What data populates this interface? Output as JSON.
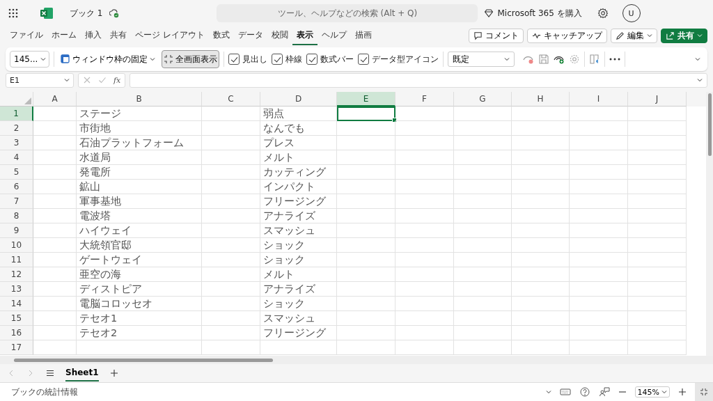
{
  "header": {
    "title": "ブック 1",
    "search": {
      "placeholder": "ツール、ヘルプなどの検索 (Alt + Q)"
    },
    "buy": "Microsoft 365 を購入",
    "avatar": "U"
  },
  "tabs": [
    {
      "label": "ファイル",
      "selected": false
    },
    {
      "label": "ホーム",
      "selected": false
    },
    {
      "label": "挿入",
      "selected": false
    },
    {
      "label": "共有",
      "selected": false
    },
    {
      "label": "ページ レイアウト",
      "selected": false
    },
    {
      "label": "数式",
      "selected": false
    },
    {
      "label": "データ",
      "selected": false
    },
    {
      "label": "校閲",
      "selected": false
    },
    {
      "label": "表示",
      "selected": true
    },
    {
      "label": "ヘルプ",
      "selected": false
    },
    {
      "label": "描画",
      "selected": false
    }
  ],
  "actions": {
    "comment": "コメント",
    "catchup": "キャッチアップ",
    "edit": "編集",
    "share": "共有"
  },
  "toolbar": {
    "zoom": "145...",
    "freeze": "ウィンドウ枠の固定",
    "fullscreen": {
      "label": "全画面表示",
      "selected": true
    },
    "checkboxes": [
      {
        "label": "見出し",
        "checked": true
      },
      {
        "label": "枠線",
        "checked": true
      },
      {
        "label": "数式バー",
        "checked": true
      },
      {
        "label": "データ型アイコン",
        "checked": true
      }
    ],
    "style": "既定"
  },
  "formula_bar": {
    "name_box": "E1",
    "function_label": "fx"
  },
  "columns": [
    {
      "label": "A",
      "selected": false
    },
    {
      "label": "B",
      "selected": false
    },
    {
      "label": "C",
      "selected": false
    },
    {
      "label": "D",
      "selected": false
    },
    {
      "label": "E",
      "selected": true
    },
    {
      "label": "F",
      "selected": false
    },
    {
      "label": "G",
      "selected": false
    },
    {
      "label": "H",
      "selected": false
    },
    {
      "label": "I",
      "selected": false
    },
    {
      "label": "J",
      "selected": false
    }
  ],
  "rows": [
    {
      "label": "1",
      "selected": true,
      "cells": [
        null,
        "ステージ",
        null,
        "弱点"
      ]
    },
    {
      "label": "2",
      "selected": false,
      "cells": [
        null,
        "市街地",
        null,
        "なんでも"
      ]
    },
    {
      "label": "3",
      "selected": false,
      "cells": [
        null,
        "石油プラットフォーム",
        null,
        "プレス"
      ]
    },
    {
      "label": "4",
      "selected": false,
      "cells": [
        null,
        "水道局",
        null,
        "メルト"
      ]
    },
    {
      "label": "5",
      "selected": false,
      "cells": [
        null,
        "発電所",
        null,
        "カッティング"
      ]
    },
    {
      "label": "6",
      "selected": false,
      "cells": [
        null,
        "鉱山",
        null,
        "インパクト"
      ]
    },
    {
      "label": "7",
      "selected": false,
      "cells": [
        null,
        "軍事基地",
        null,
        "フリージング"
      ]
    },
    {
      "label": "8",
      "selected": false,
      "cells": [
        null,
        "電波塔",
        null,
        "アナライズ"
      ]
    },
    {
      "label": "9",
      "selected": false,
      "cells": [
        null,
        "ハイウェイ",
        null,
        "スマッシュ"
      ]
    },
    {
      "label": "10",
      "selected": false,
      "cells": [
        null,
        "大統領官邸",
        null,
        "ショック"
      ]
    },
    {
      "label": "11",
      "selected": false,
      "cells": [
        null,
        "ゲートウェイ",
        null,
        "ショック"
      ]
    },
    {
      "label": "12",
      "selected": false,
      "cells": [
        null,
        "亜空の海",
        null,
        "メルト"
      ]
    },
    {
      "label": "13",
      "selected": false,
      "cells": [
        null,
        "ディストピア",
        null,
        "アナライズ"
      ]
    },
    {
      "label": "14",
      "selected": false,
      "cells": [
        null,
        "電脳コロッセオ",
        null,
        "ショック"
      ]
    },
    {
      "label": "15",
      "selected": false,
      "cells": [
        null,
        "テセオ1",
        null,
        "スマッシュ"
      ]
    },
    {
      "label": "16",
      "selected": false,
      "cells": [
        null,
        "テセオ2",
        null,
        "フリージング"
      ]
    },
    {
      "label": "17",
      "selected": false,
      "cells": []
    }
  ],
  "sheets": [
    {
      "label": "Sheet1",
      "selected": true
    }
  ],
  "status_bar": {
    "text": "ブックの統計情報",
    "zoom": "145%"
  }
}
